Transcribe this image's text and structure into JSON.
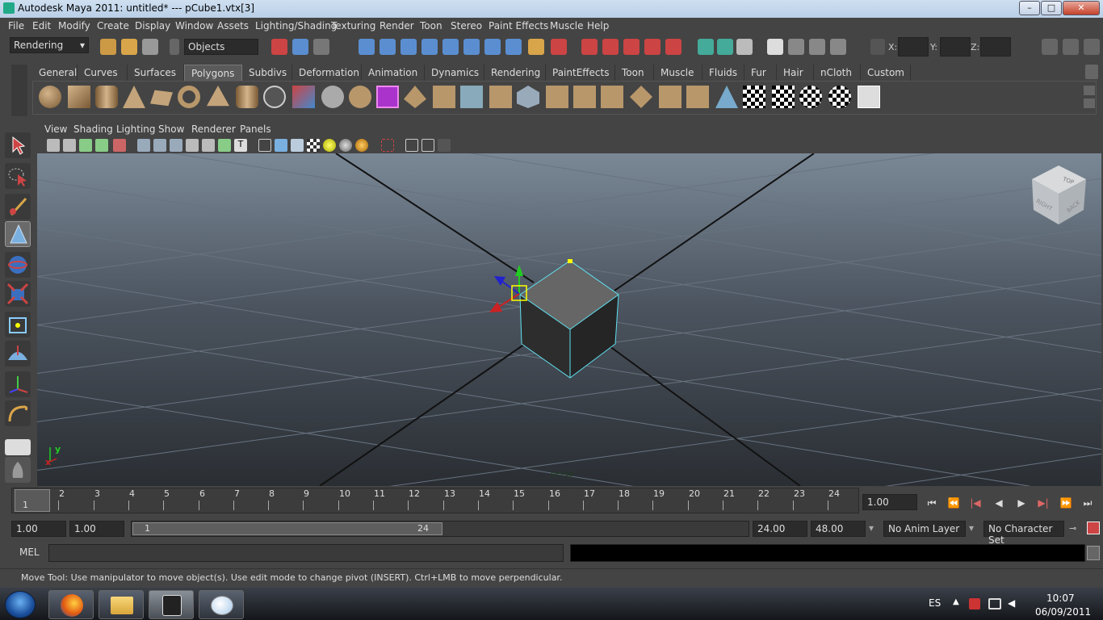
{
  "window": {
    "title": "Autodesk Maya 2011: untitled*   ---   pCube1.vtx[3]",
    "minimize": "–",
    "maximize": "□",
    "close": "✕"
  },
  "menubar": [
    "File",
    "Edit",
    "Modify",
    "Create",
    "Display",
    "Window",
    "Assets",
    "Lighting/Shading",
    "Texturing",
    "Render",
    "Toon",
    "Stereo",
    "Paint Effects",
    "Muscle",
    "Help"
  ],
  "statusline": {
    "menuset": "Rendering",
    "selection_mask": "Objects",
    "x_label": "X:",
    "y_label": "Y:",
    "z_label": "Z:"
  },
  "shelf": {
    "tabs": [
      "General",
      "Curves",
      "Surfaces",
      "Polygons",
      "Subdivs",
      "Deformation",
      "Animation",
      "Dynamics",
      "Rendering",
      "PaintEffects",
      "Toon",
      "Muscle",
      "Fluids",
      "Fur",
      "Hair",
      "nCloth",
      "Custom"
    ],
    "active_tab": "Polygons"
  },
  "panel": {
    "menus": [
      "View",
      "Shading",
      "Lighting",
      "Show",
      "Renderer",
      "Panels"
    ],
    "camera_label": "persp"
  },
  "viewcube": {
    "top": "TOP",
    "right": "RIGHT",
    "back": "BACK"
  },
  "axis": {
    "x": "x",
    "y": "y"
  },
  "timeline": {
    "ticks": [
      "1",
      "2",
      "3",
      "4",
      "5",
      "6",
      "7",
      "8",
      "9",
      "10",
      "11",
      "12",
      "13",
      "14",
      "15",
      "16",
      "17",
      "18",
      "19",
      "20",
      "21",
      "22",
      "23",
      "24"
    ],
    "current_marker": "1",
    "current_frame": "1.00"
  },
  "playback": {
    "goto_start": "⏮",
    "step_back_key": "⏪",
    "step_back_frame": "|◀",
    "play_back": "◀",
    "play_forward": "▶",
    "step_forward_frame": "▶|",
    "step_forward_key": "⏩",
    "goto_end": "⏭"
  },
  "range": {
    "start": "1.00",
    "playback_start": "1.00",
    "slider_start": "1",
    "slider_end": "24",
    "playback_end": "24.00",
    "end": "48.00",
    "anim_layer": "No Anim Layer",
    "character_set": "No Character Set"
  },
  "command": {
    "mel_label": "MEL",
    "help_text": "Move Tool: Use manipulator to move object(s). Use edit mode to change pivot (INSERT).  Ctrl+LMB to move perpendicular."
  },
  "taskbar": {
    "language": "ES",
    "time": "10:07",
    "date": "06/09/2011"
  }
}
